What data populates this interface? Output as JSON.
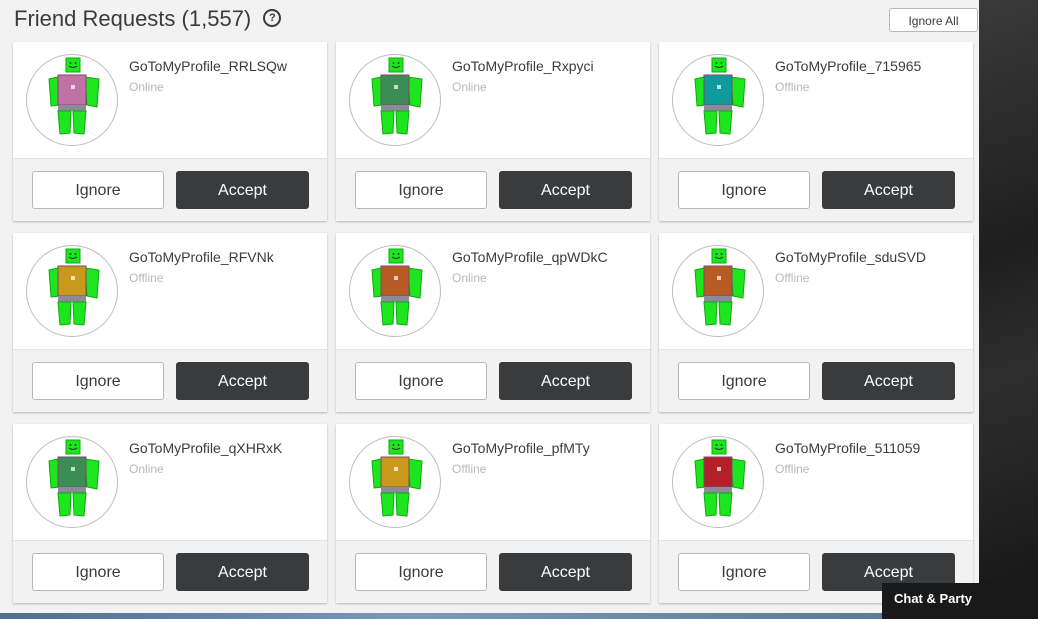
{
  "header": {
    "title": "Friend Requests",
    "count": "(1,557)",
    "help_icon": "question-circle-icon",
    "ignore_all_label": "Ignore All"
  },
  "buttons": {
    "ignore_label": "Ignore",
    "accept_label": "Accept"
  },
  "requests": [
    {
      "username": "GoToMyProfile_RRLSQw",
      "status": "Online",
      "torso_color": "#c071a6"
    },
    {
      "username": "GoToMyProfile_Rxpyci",
      "status": "Online",
      "torso_color": "#3c8c55"
    },
    {
      "username": "GoToMyProfile_715965",
      "status": "Offline",
      "torso_color": "#0f9b9b"
    },
    {
      "username": "GoToMyProfile_RFVNk",
      "status": "Offline",
      "torso_color": "#c99a1a"
    },
    {
      "username": "GoToMyProfile_qpWDkC",
      "status": "Online",
      "torso_color": "#b85a23"
    },
    {
      "username": "GoToMyProfile_sduSVD",
      "status": "Offline",
      "torso_color": "#b85a23"
    },
    {
      "username": "GoToMyProfile_qXHRxK",
      "status": "Online",
      "torso_color": "#3c8c55"
    },
    {
      "username": "GoToMyProfile_pfMTy",
      "status": "Offline",
      "torso_color": "#c99a1a"
    },
    {
      "username": "GoToMyProfile_511059",
      "status": "Offline",
      "torso_color": "#b3202a"
    }
  ],
  "chat": {
    "label": "Chat & Party"
  },
  "colors": {
    "avatar_green": "#1ee61e",
    "accept_bg": "#393b3d",
    "status_text": "#b8b8b8"
  }
}
